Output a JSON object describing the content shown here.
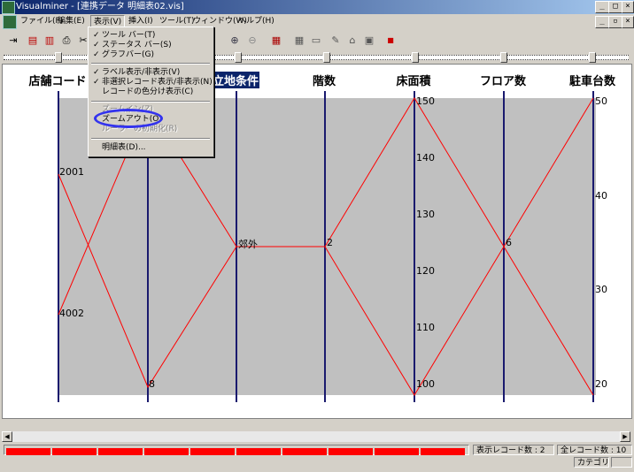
{
  "window": {
    "title": "Visualminer - [連携データ 明細表02.vis]",
    "controls": [
      "_",
      "□",
      "×"
    ],
    "doc_controls": [
      "_",
      "▫",
      "×"
    ]
  },
  "menubar": {
    "items": [
      "ファイル(F)",
      "編集(E)",
      "表示(V)",
      "挿入(I)",
      "ツール(T)",
      "ウィンドウ(W)",
      "ヘルプ(H)"
    ]
  },
  "view_menu": {
    "items": [
      {
        "label": "ツール バー(T)",
        "checked": true,
        "disabled": false
      },
      {
        "label": "ステータス バー(S)",
        "checked": true,
        "disabled": false
      },
      {
        "label": "グラフバー(G)",
        "checked": true,
        "disabled": false
      },
      {
        "label": "ラベル表示/非表示(V)",
        "checked": true,
        "disabled": false
      },
      {
        "label": "非選択レコード表示/非表示(N)",
        "checked": true,
        "disabled": false
      },
      {
        "label": "レコードの色分け表示(C)",
        "checked": false,
        "disabled": false
      },
      {
        "label": "ズームイン(Z)",
        "checked": false,
        "disabled": true
      },
      {
        "label": "ズームアウト(O)",
        "checked": false,
        "disabled": false
      },
      {
        "label": "ルーラーの初期化(R)",
        "checked": false,
        "disabled": true
      },
      {
        "label": "明細表(D)...",
        "checked": false,
        "disabled": false
      }
    ]
  },
  "chart": {
    "axes": [
      {
        "name": "店舗コード",
        "selected": false
      },
      {
        "name": "",
        "selected": false
      },
      {
        "name": "立地条件",
        "selected": true
      },
      {
        "name": "階数",
        "selected": false
      },
      {
        "name": "床面積",
        "selected": false
      },
      {
        "name": "フロア数",
        "selected": false
      },
      {
        "name": "駐車台数",
        "selected": false
      }
    ],
    "tick_labels": {
      "store_code": [
        "2001",
        "4002"
      ],
      "axis2": [
        "8"
      ],
      "location": [
        "郊外"
      ],
      "floors": [
        "2"
      ],
      "floor_area": [
        "150",
        "140",
        "130",
        "120",
        "110",
        "100"
      ],
      "floor_count": [
        "6"
      ],
      "parking": [
        "50",
        "40",
        "30",
        "20"
      ]
    },
    "colors": {
      "line": "#ff0000",
      "axis": "#1a1a6e",
      "plot_bg": "#c0c0c0",
      "selected": "#0a246a"
    }
  },
  "chart_data": {
    "type": "parallel-coordinates",
    "axes": [
      "店舗コード",
      "",
      "立地条件",
      "階数",
      "床面積",
      "フロア数",
      "駐車台数"
    ],
    "records": [
      {
        "店舗コード": "2001",
        "立地条件": "郊外",
        "階数": 2,
        "床面積": 100,
        "フロア数": 6,
        "駐車台数": 50
      },
      {
        "店舗コード": "4002",
        "立地条件": "郊外",
        "階数": 2,
        "床面積": 150,
        "フロア数": 6,
        "駐車台数": 20
      }
    ],
    "ylim_floor_area": [
      100,
      150
    ],
    "ylim_parking": [
      20,
      50
    ]
  },
  "status": {
    "displayed_records": "表示レコード数 : 2",
    "total_records": "全レコード数 : 10",
    "category": "カテゴリ",
    "progress_segments": 10
  }
}
